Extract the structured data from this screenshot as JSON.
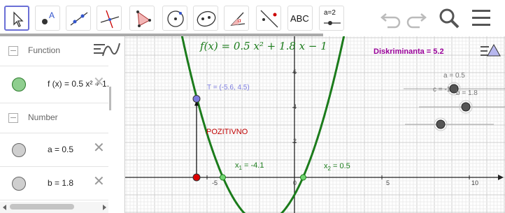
{
  "toolbar": {
    "text_tool_label": "ABC",
    "slider_tool_label": "a=2",
    "tools": [
      "select-tool",
      "point-tool",
      "line-tool",
      "perpendicular-tool",
      "polygon-tool",
      "circle-tool",
      "conic-tool",
      "angle-tool",
      "reflect-tool",
      "text-tool",
      "slider-tool"
    ]
  },
  "algebra": {
    "function_header": "Function",
    "function_expr": "f (x) = 0.5 x² + 1.",
    "number_header": "Number",
    "numbers": [
      {
        "label": "a = 0.5"
      },
      {
        "label": "b = 1.8"
      }
    ]
  },
  "graphics": {
    "function_label": "f(x) = 0.5 x² + 1.8 x − 1",
    "discriminant_label": "Diskriminanta = 5.2",
    "point_t_label": "T = (-5.6, 4.5)",
    "positive_label": "POZITIVNO",
    "root1_label": "x",
    "root1_sub": "1",
    "root1_value": " = -4.1",
    "root2_label": "x",
    "root2_sub": "2",
    "root2_value": " = 0.5",
    "sliders": [
      {
        "label": "a = 0.5",
        "value": 0.5
      },
      {
        "label": "b = 1.8",
        "value": 1.8
      },
      {
        "label": "c = -1",
        "value": -1
      }
    ],
    "x_ticks": [
      "-5",
      "0",
      "5",
      "10"
    ],
    "y_ticks": [
      "2",
      "4",
      "6"
    ],
    "colors": {
      "curve": "#1b7b1b",
      "point_t": "#7b7bdf",
      "label_red": "#c00000",
      "purple": "#990099",
      "root": "#1b7b1b"
    }
  }
}
